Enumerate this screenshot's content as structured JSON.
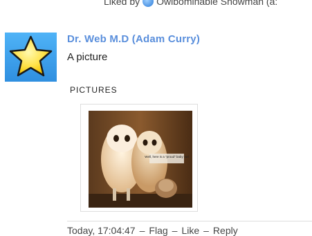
{
  "liked": {
    "prefix": "Liked by",
    "user": "Owlbominable Snowman (a:"
  },
  "post": {
    "author": "Dr. Web M.D (Adam Curry)",
    "text": "A picture",
    "section": "PICTURES",
    "image_caption": "Well, here is a \"proud\" baby owl"
  },
  "footer": {
    "timestamp": "Today, 17:04:47",
    "flag": "Flag",
    "like": "Like",
    "reply": "Reply"
  }
}
